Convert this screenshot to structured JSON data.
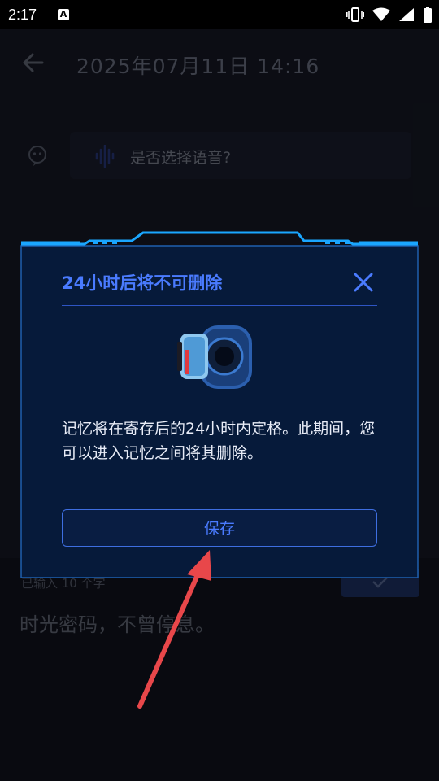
{
  "status_bar": {
    "time": "2:17",
    "app_badge": "A"
  },
  "header": {
    "title": "2025年07月11日  14:16"
  },
  "chat": {
    "voice_prompt": "是否选择语音?"
  },
  "composer": {
    "char_count": "已输入 10 个字",
    "memo_text": "时光密码，不曾停息。"
  },
  "dialog": {
    "title": "24小时后将不可删除",
    "body": "记忆将在寄存后的24小时内定格。此期间，您可以进入记忆之间将其删除。",
    "save_label": "保存"
  },
  "colors": {
    "accent": "#4a7bff",
    "dialog_bg": "#061a3a",
    "frame": "#1aa6ff",
    "arrow": "#e8474a"
  },
  "icons": [
    "back-arrow-icon",
    "bot-icon",
    "voice-wave-icon",
    "close-icon",
    "check-icon",
    "vibrate-icon",
    "wifi-icon",
    "signal-icon",
    "battery-icon"
  ]
}
